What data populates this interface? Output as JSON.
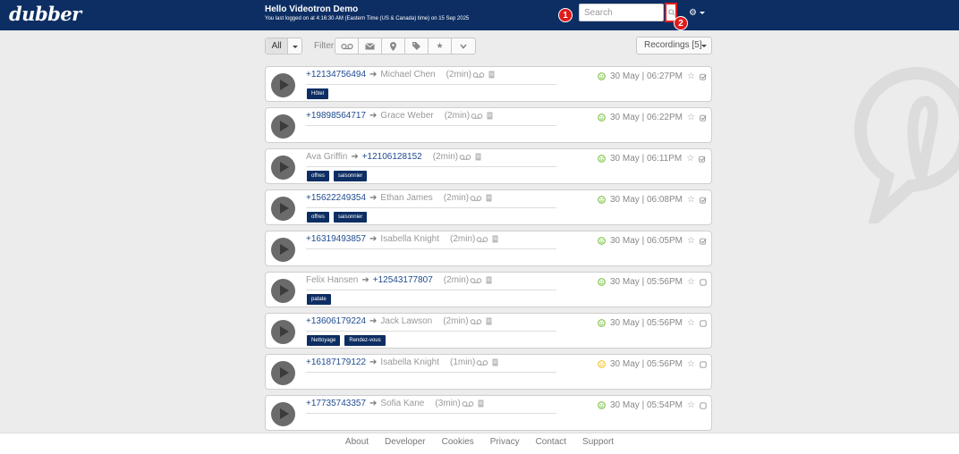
{
  "header": {
    "logo": "dubber",
    "greeting": "Hello Videotron Demo",
    "last_login": "You last logged on at 4:16:30 AM (Eastern Time (US & Canada) time) on 15 Sep 2025",
    "search_placeholder": "Search",
    "marker_1": "1",
    "marker_2": "2",
    "settings_icon": "gear-icon"
  },
  "toolbar": {
    "all_label": "All",
    "filter_label": "Filter",
    "filter_icons": [
      "voicemail-icon",
      "envelope-icon",
      "map-marker-icon",
      "tag-icon",
      "star-icon",
      "chevron-down-icon"
    ],
    "recordings_label": "Recordings [5]"
  },
  "recordings": [
    {
      "from": "+12134756494",
      "to": "Michael Chen",
      "from_is_number": true,
      "duration": "(2min)",
      "date": "30 May | 06:27PM",
      "tags": [
        "Hôtel"
      ],
      "mood": "green",
      "checked": true
    },
    {
      "from": "+19898564717",
      "to": "Grace Weber",
      "from_is_number": true,
      "duration": "(2min)",
      "date": "30 May | 06:22PM",
      "tags": [],
      "mood": "green",
      "checked": true
    },
    {
      "from": "Ava Griffin",
      "to": "+12106128152",
      "from_is_number": false,
      "duration": "(2min)",
      "date": "30 May | 06:11PM",
      "tags": [
        "offres",
        "saisonnier"
      ],
      "mood": "green",
      "checked": true
    },
    {
      "from": "+15622249354",
      "to": "Ethan James",
      "from_is_number": true,
      "duration": "(2min)",
      "date": "30 May | 06:08PM",
      "tags": [
        "offres",
        "saisonnier"
      ],
      "mood": "green",
      "checked": true
    },
    {
      "from": "+16319493857",
      "to": "Isabella Knight",
      "from_is_number": true,
      "duration": "(2min)",
      "date": "30 May | 06:05PM",
      "tags": [],
      "mood": "green",
      "checked": true
    },
    {
      "from": "Felix Hansen",
      "to": "+12543177807",
      "from_is_number": false,
      "duration": "(2min)",
      "date": "30 May | 05:56PM",
      "tags": [
        "patate"
      ],
      "mood": "green",
      "checked": false
    },
    {
      "from": "+13606179224",
      "to": "Jack Lawson",
      "from_is_number": true,
      "duration": "(2min)",
      "date": "30 May | 05:56PM",
      "tags": [
        "Nettoyage",
        "Rendez-vous"
      ],
      "mood": "green",
      "checked": false
    },
    {
      "from": "+16187179122",
      "to": "Isabella Knight",
      "from_is_number": true,
      "duration": "(1min)",
      "date": "30 May | 05:56PM",
      "tags": [],
      "mood": "yellow",
      "checked": false
    },
    {
      "from": "+17735743357",
      "to": "Sofia Kane",
      "from_is_number": true,
      "duration": "(3min)",
      "date": "30 May | 05:54PM",
      "tags": [],
      "mood": "green",
      "checked": false
    }
  ],
  "colors": {
    "header_bg": "#0d2e63",
    "tag_bg": "#0d2e63",
    "number_text": "#1f4b8f",
    "marker_red": "#e01b1b",
    "mood_green": "#7ac143",
    "mood_yellow": "#f2c12e"
  },
  "footer": {
    "links": [
      "About",
      "Developer",
      "Cookies",
      "Privacy",
      "Contact",
      "Support"
    ]
  }
}
